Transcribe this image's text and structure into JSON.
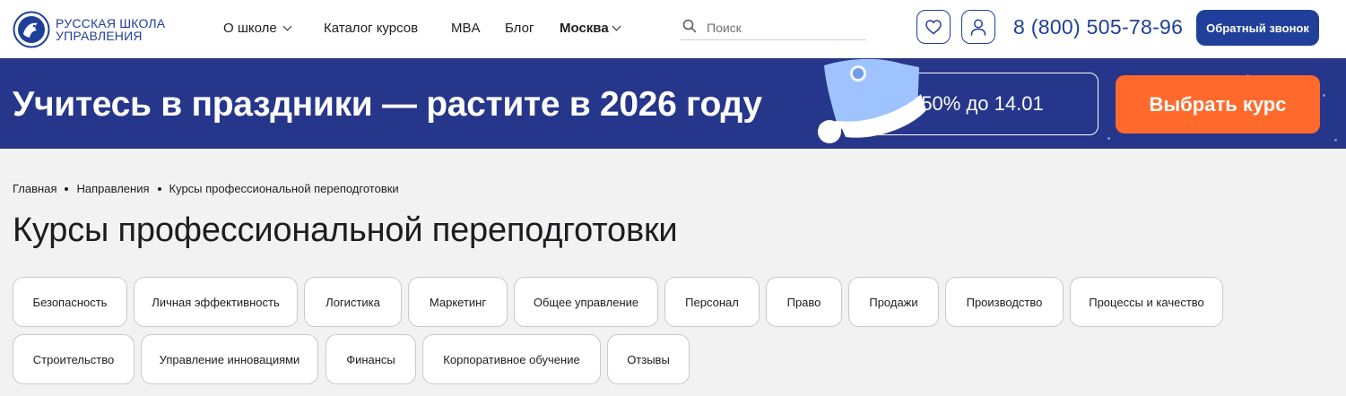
{
  "header": {
    "logo_text_line1": "РУССКАЯ ШКОЛА",
    "logo_text_line2": "УПРАВЛЕНИЯ",
    "nav": {
      "about": "О школе",
      "catalog": "Каталог курсов",
      "mba": "MBA",
      "blog": "Блог",
      "city": "Москва"
    },
    "search_placeholder": "Поиск",
    "phone": "8 (800) 505-78-96",
    "callback_label": "Обратный звонок"
  },
  "banner": {
    "title": "Учитесь в праздники — растите в 2026 году",
    "promo": "-50% до 14.01",
    "cta": "Выбрать курс",
    "background_color": "#26368a",
    "cta_color": "#ff6a2c"
  },
  "breadcrumb": [
    "Главная",
    "Направления",
    "Курсы профессиональной переподготовки"
  ],
  "page_title": "Курсы профессиональной переподготовки",
  "categories_row1": [
    "Безопасность",
    "Личная эффективность",
    "Логистика",
    "Маркетинг",
    "Общее управление",
    "Персонал",
    "Право",
    "Продажи",
    "Производство",
    "Процессы и качество"
  ],
  "categories_row2": [
    "Строительство",
    "Управление инновациями",
    "Финансы",
    "Корпоративное обучение",
    "Отзывы"
  ],
  "colors": {
    "brand": "#1f3f9a",
    "page_bg": "#f2f2f2"
  }
}
